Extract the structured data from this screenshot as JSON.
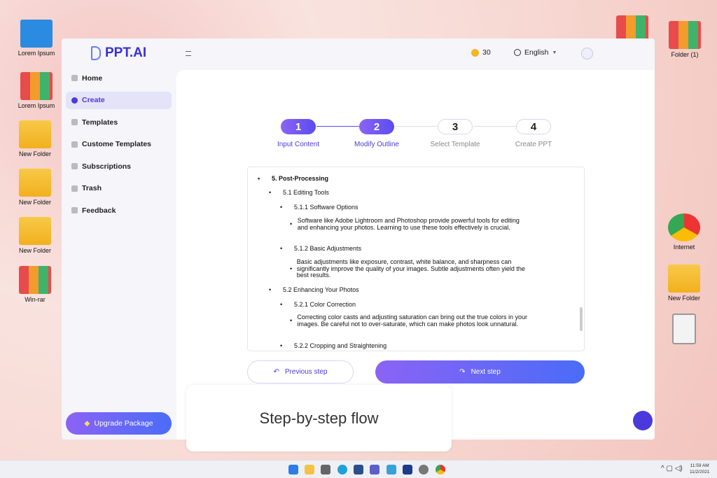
{
  "desktop": {
    "left": [
      "Lorem Ipsum",
      "Lorem Ipsum",
      "New Folder",
      "New Folder",
      "New Folder",
      "Win-rar"
    ],
    "right": [
      "Folder (1)",
      "Internet",
      "New Folder"
    ]
  },
  "app": {
    "brand": "PPT.AI",
    "credits": "30",
    "language": "English",
    "nav": [
      "Home",
      "Create",
      "Templates",
      "Custome Templates",
      "Subscriptions",
      "Trash",
      "Feedback"
    ],
    "upgrade": "Upgrade Package",
    "steps": [
      {
        "num": "1",
        "label": "Input Content"
      },
      {
        "num": "2",
        "label": "Modify Outline"
      },
      {
        "num": "3",
        "label": "Select Template"
      },
      {
        "num": "4",
        "label": "Create PPT"
      }
    ],
    "accent": "#4a3adb",
    "outline": [
      "5. Post-Processing",
      "5.1 Editing Tools",
      "5.1.1 Software Options",
      "Software like Adobe Lightroom and Photoshop provide powerful tools for editing and enhancing your photos. Learning to use these tools effectively is crucial.",
      "5.1.2 Basic Adjustments",
      "Basic adjustments like exposure, contrast, white balance, and sharpness can significantly improve the quality of your images. Subtle adjustments often yield the best results.",
      "5.2 Enhancing Your Photos",
      "5.2.1 Color Correction",
      "Correcting color casts and adjusting saturation can bring out the true colors in your images. Be careful not to over-saturate, which can make photos look unnatural.",
      "5.2.2 Cropping and Straightening"
    ],
    "prev": "Previous step",
    "next": "Next step"
  },
  "caption": "Step-by-step flow",
  "taskbar": {
    "time": "11:59 AM",
    "date": "11/2/2021"
  }
}
